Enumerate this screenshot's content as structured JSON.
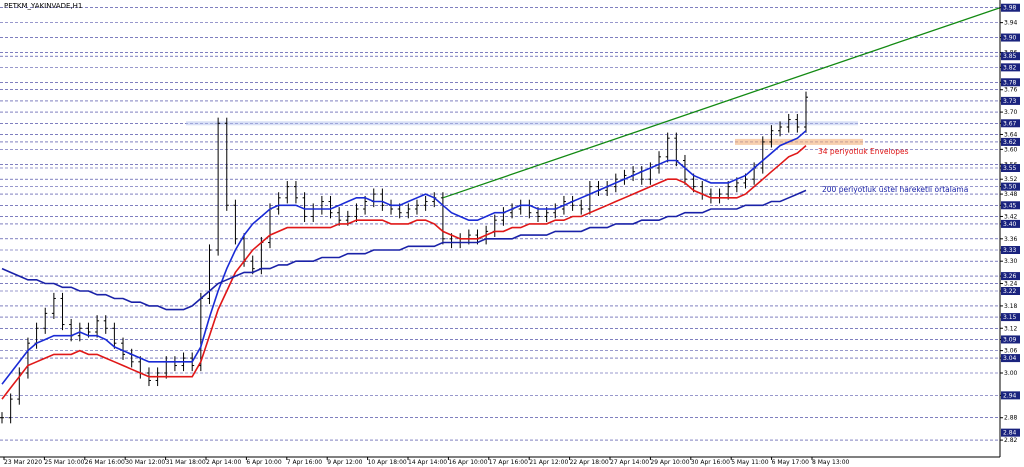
{
  "chart_data": {
    "type": "line",
    "title": "PETKM_YAKINVADE,H1",
    "xlabel": "",
    "ylabel": "",
    "ylim": [
      2.78,
      3.99
    ],
    "y_ticks": [
      2.82,
      2.88,
      2.94,
      3.0,
      3.04,
      3.06,
      3.09,
      3.12,
      3.15,
      3.18,
      3.22,
      3.24,
      3.26,
      3.3,
      3.33,
      3.36,
      3.4,
      3.42,
      3.45,
      3.48,
      3.5,
      3.52,
      3.55,
      3.56,
      3.6,
      3.62,
      3.64,
      3.67,
      3.7,
      3.73,
      3.76,
      3.78,
      3.82,
      3.85,
      3.86,
      3.9,
      3.94,
      3.98
    ],
    "highlighted_levels": [
      {
        "value": 3.98,
        "color": "#1a237e"
      },
      {
        "value": 3.9,
        "color": "#1a237e"
      },
      {
        "value": 3.85,
        "color": "#1a237e"
      },
      {
        "value": 3.82,
        "color": "#1a237e"
      },
      {
        "value": 3.78,
        "color": "#1a237e"
      },
      {
        "value": 3.73,
        "color": "#1a237e"
      },
      {
        "value": 3.67,
        "color": "#1a237e"
      },
      {
        "value": 3.62,
        "color": "#1a237e"
      },
      {
        "value": 3.55,
        "color": "#1a237e"
      },
      {
        "value": 3.5,
        "color": "#1a237e"
      },
      {
        "value": 3.45,
        "color": "#1a237e"
      },
      {
        "value": 3.4,
        "color": "#1a237e"
      },
      {
        "value": 3.33,
        "color": "#1a237e"
      },
      {
        "value": 3.26,
        "color": "#1a237e"
      },
      {
        "value": 3.22,
        "color": "#1a237e"
      },
      {
        "value": 3.15,
        "color": "#1a237e"
      },
      {
        "value": 3.09,
        "color": "#1a237e"
      },
      {
        "value": 3.04,
        "color": "#1a237e"
      },
      {
        "value": 2.94,
        "color": "#1a237e"
      },
      {
        "value": 2.84,
        "color": "#1a237e"
      }
    ],
    "x_labels": [
      "23 Mar 2020",
      "25 Mar 10:00",
      "26 Mar 16:00",
      "30 Mar 12:00",
      "31 Mar 18:00",
      "2 Apr 14:00",
      "6 Apr 10:00",
      "7 Apr 16:00",
      "9 Apr 12:00",
      "10 Apr 18:00",
      "14 Apr 14:00",
      "16 Apr 10:00",
      "17 Apr 16:00",
      "21 Apr 12:00",
      "22 Apr 18:00",
      "27 Apr 14:00",
      "29 Apr 10:00",
      "30 Apr 16:00",
      "5 May 11:00",
      "6 May 17:00",
      "8 May 13:00"
    ],
    "series": [
      {
        "name": "",
        "color": "#000000",
        "kind": "price",
        "values": [
          2.88,
          2.93,
          3.0,
          3.08,
          3.12,
          3.16,
          3.2,
          3.13,
          3.1,
          3.12,
          3.11,
          3.14,
          3.12,
          3.08,
          3.05,
          3.03,
          3.0,
          2.98,
          3.0,
          3.03,
          3.02,
          3.04,
          3.02,
          3.2,
          3.33,
          3.67,
          3.45,
          3.36,
          3.3,
          3.28,
          3.35,
          3.44,
          3.47,
          3.5,
          3.47,
          3.42,
          3.44,
          3.46,
          3.43,
          3.41,
          3.42,
          3.44,
          3.46,
          3.48,
          3.45,
          3.44,
          3.43,
          3.44,
          3.45,
          3.46,
          3.47,
          3.36,
          3.35,
          3.36,
          3.37,
          3.36,
          3.38,
          3.41,
          3.43,
          3.44,
          3.45,
          3.43,
          3.42,
          3.43,
          3.44,
          3.46,
          3.45,
          3.44,
          3.5,
          3.49,
          3.5,
          3.52,
          3.53,
          3.54,
          3.52,
          3.55,
          3.58,
          3.63,
          3.57,
          3.52,
          3.5,
          3.48,
          3.47,
          3.48,
          3.5,
          3.51,
          3.52,
          3.55,
          3.62,
          3.65,
          3.66,
          3.68,
          3.66,
          3.74
        ]
      },
      {
        "name": "",
        "color": "#1a2bd6",
        "kind": "envelope-upper",
        "values": [
          2.97,
          3.0,
          3.03,
          3.06,
          3.08,
          3.09,
          3.1,
          3.1,
          3.1,
          3.11,
          3.1,
          3.1,
          3.09,
          3.07,
          3.06,
          3.05,
          3.04,
          3.03,
          3.03,
          3.03,
          3.03,
          3.03,
          3.03,
          3.07,
          3.15,
          3.22,
          3.28,
          3.33,
          3.37,
          3.4,
          3.42,
          3.44,
          3.45,
          3.45,
          3.45,
          3.44,
          3.44,
          3.44,
          3.44,
          3.45,
          3.46,
          3.47,
          3.47,
          3.46,
          3.46,
          3.45,
          3.45,
          3.46,
          3.47,
          3.48,
          3.47,
          3.45,
          3.43,
          3.42,
          3.41,
          3.41,
          3.42,
          3.43,
          3.43,
          3.44,
          3.45,
          3.45,
          3.44,
          3.44,
          3.44,
          3.45,
          3.46,
          3.47,
          3.48,
          3.49,
          3.5,
          3.51,
          3.52,
          3.53,
          3.54,
          3.55,
          3.56,
          3.57,
          3.57,
          3.55,
          3.53,
          3.52,
          3.51,
          3.51,
          3.51,
          3.52,
          3.53,
          3.55,
          3.57,
          3.59,
          3.61,
          3.62,
          3.63,
          3.65
        ]
      },
      {
        "name": "",
        "color": "#e01818",
        "kind": "envelope-lower",
        "values": [
          2.93,
          2.96,
          2.99,
          3.02,
          3.03,
          3.04,
          3.05,
          3.05,
          3.05,
          3.06,
          3.05,
          3.05,
          3.04,
          3.03,
          3.02,
          3.01,
          3.0,
          2.99,
          2.99,
          2.99,
          2.99,
          2.99,
          2.99,
          3.03,
          3.1,
          3.17,
          3.22,
          3.27,
          3.3,
          3.33,
          3.35,
          3.37,
          3.38,
          3.39,
          3.39,
          3.39,
          3.39,
          3.39,
          3.39,
          3.4,
          3.4,
          3.41,
          3.41,
          3.41,
          3.41,
          3.4,
          3.4,
          3.4,
          3.41,
          3.41,
          3.4,
          3.38,
          3.37,
          3.36,
          3.36,
          3.36,
          3.37,
          3.38,
          3.38,
          3.39,
          3.39,
          3.4,
          3.4,
          3.4,
          3.41,
          3.41,
          3.42,
          3.42,
          3.43,
          3.44,
          3.45,
          3.46,
          3.47,
          3.48,
          3.49,
          3.5,
          3.51,
          3.52,
          3.52,
          3.51,
          3.49,
          3.48,
          3.47,
          3.47,
          3.47,
          3.47,
          3.48,
          3.5,
          3.52,
          3.54,
          3.56,
          3.58,
          3.59,
          3.61
        ]
      },
      {
        "name": "",
        "color": "#1a22a8",
        "kind": "ema200",
        "values": [
          3.28,
          3.27,
          3.26,
          3.25,
          3.25,
          3.24,
          3.24,
          3.23,
          3.23,
          3.22,
          3.22,
          3.21,
          3.21,
          3.2,
          3.2,
          3.19,
          3.19,
          3.18,
          3.18,
          3.17,
          3.17,
          3.17,
          3.18,
          3.2,
          3.22,
          3.24,
          3.25,
          3.26,
          3.27,
          3.27,
          3.28,
          3.28,
          3.29,
          3.29,
          3.3,
          3.3,
          3.3,
          3.31,
          3.31,
          3.31,
          3.32,
          3.32,
          3.32,
          3.33,
          3.33,
          3.33,
          3.33,
          3.34,
          3.34,
          3.34,
          3.34,
          3.35,
          3.35,
          3.35,
          3.35,
          3.35,
          3.36,
          3.36,
          3.36,
          3.36,
          3.37,
          3.37,
          3.37,
          3.37,
          3.38,
          3.38,
          3.38,
          3.38,
          3.39,
          3.39,
          3.39,
          3.4,
          3.4,
          3.4,
          3.41,
          3.41,
          3.41,
          3.42,
          3.42,
          3.43,
          3.43,
          3.43,
          3.44,
          3.44,
          3.44,
          3.44,
          3.45,
          3.45,
          3.45,
          3.46,
          3.46,
          3.47,
          3.48,
          3.49
        ]
      }
    ],
    "annotations": [
      {
        "text": "34 periyotluk Envelopes",
        "color": "#e01818"
      },
      {
        "text": "200 periyotluk üstel hareketli ortalama",
        "color": "#1a22a8"
      }
    ],
    "trendline": {
      "color": "#138a13",
      "from": {
        "index": 51,
        "value": 3.47
      },
      "to": {
        "index": 120,
        "value": 3.98
      }
    },
    "horizontal_zones": [
      {
        "value": 3.67,
        "color": "#b8c4ee",
        "kind": "resistance"
      },
      {
        "value": 3.62,
        "color": "#f3b07a",
        "kind": "support"
      }
    ],
    "grid": true,
    "legend": "none"
  }
}
